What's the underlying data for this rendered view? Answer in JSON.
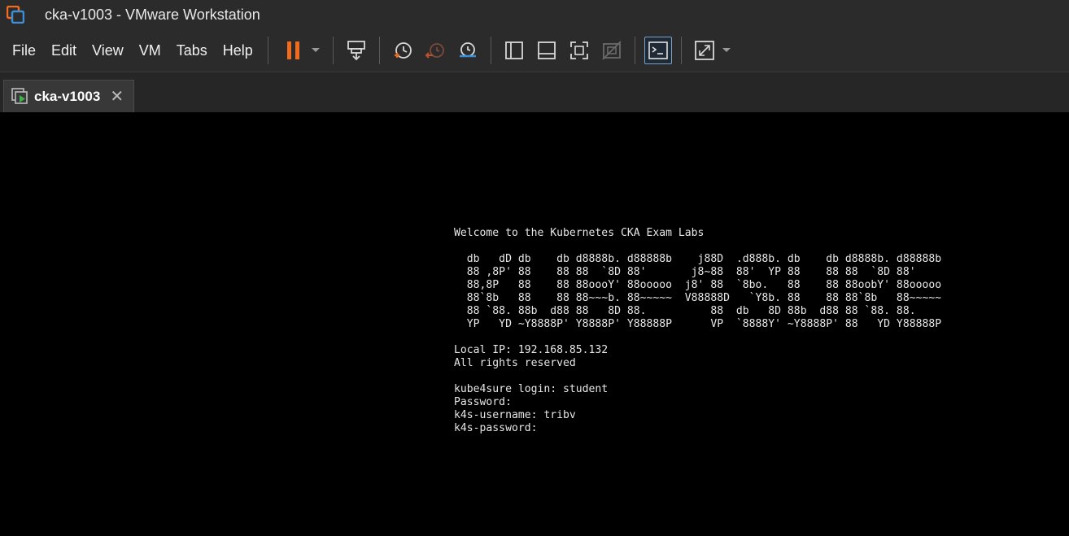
{
  "window": {
    "title": "cka-v1003 - VMware Workstation"
  },
  "menu": [
    {
      "label": "File"
    },
    {
      "label": "Edit"
    },
    {
      "label": "View"
    },
    {
      "label": "VM"
    },
    {
      "label": "Tabs"
    },
    {
      "label": "Help"
    }
  ],
  "colors": {
    "accent_orange": "#f26b1d",
    "toolbar_bg": "#2b2b2b",
    "console_bg": "#000000",
    "active_border": "#7aa0c8"
  },
  "toolbar_icons": [
    "pause-icon",
    "send-ctrl-alt-del-icon",
    "take-snapshot-icon",
    "revert-snapshot-icon",
    "snapshot-manager-icon",
    "show-library-icon",
    "thumbnail-bar-icon",
    "full-screen-icon",
    "unity-icon",
    "console-view-icon",
    "stretch-guest-icon"
  ],
  "tab": {
    "label": "cka-v1003",
    "close": "✕"
  },
  "console": {
    "lines": [
      "Welcome to the Kubernetes CKA Exam Labs",
      "",
      "  db   dD db    db d8888b. d88888b    j88D  .d888b. db    db d8888b. d88888b",
      "  88 ,8P' 88    88 88  `8D 88'       j8~88  88'  YP 88    88 88  `8D 88'",
      "  88,8P   88    88 88oooY' 88ooooo  j8' 88  `8bo.   88    88 88oobY' 88ooooo",
      "  88`8b   88    88 88~~~b. 88~~~~~  V88888D   `Y8b. 88    88 88`8b   88~~~~~",
      "  88 `88. 88b  d88 88   8D 88.          88  db   8D 88b  d88 88 `88. 88.",
      "  YP   YD ~Y8888P' Y8888P' Y88888P      VP  `8888Y' ~Y8888P' 88   YD Y88888P",
      "",
      "Local IP: 192.168.85.132",
      "All rights reserved",
      "",
      "kube4sure login: student",
      "Password:",
      "k4s-username: tribv",
      "k4s-password:"
    ]
  }
}
